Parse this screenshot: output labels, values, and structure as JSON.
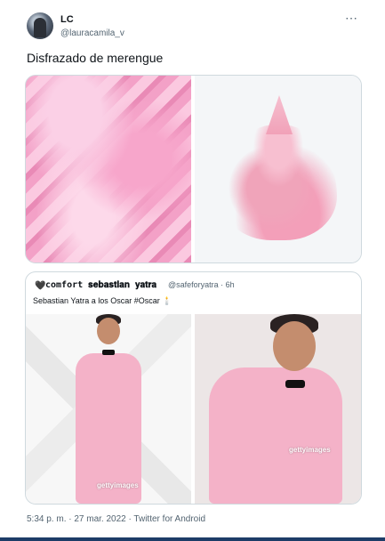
{
  "author": {
    "name": "LC",
    "handle": "@lauracamila_v"
  },
  "more_icon": "⋯",
  "tweet_text": "Disfrazado de merengue",
  "quoted_tweet": {
    "heart_icon": "🖤",
    "name": "comfort 𝐬𝐞𝐛𝐚𝐬𝐭𝐢𝐚𝐧 𝐲𝐚𝐭𝐫𝐚",
    "handle_time": "@safeforyatra · 6h",
    "text": "Sebastian Yatra a los Oscar #Oscar 🕯️"
  },
  "watermarks": [
    "gettyimages",
    "gettyimages"
  ],
  "footer": "5:34 p. m. · 27 mar. 2022 · Twitter for Android",
  "colors": {
    "text_primary": "#0f1419",
    "text_secondary": "#536471",
    "border": "#cfd9de",
    "bottom_bar": "#1d3c67"
  }
}
